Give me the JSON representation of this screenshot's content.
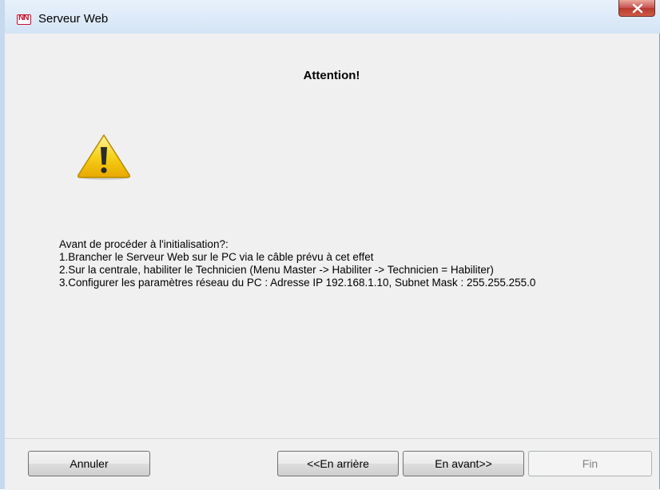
{
  "window": {
    "title": "Serveur Web",
    "icon_label": "NN",
    "close_label": "close"
  },
  "main": {
    "heading": "Attention!",
    "warning_icon": "warning-triangle-icon",
    "lines": [
      "Avant de procéder à l'initialisation?:",
      "1.Brancher le Serveur Web sur le PC via le câble prévu à cet effet",
      "2.Sur la centrale, habiliter le Technicien (Menu Master -> Habiliter -> Technicien = Habiliter)",
      "3.Configurer les paramètres réseau du PC : Adresse IP 192.168.1.10, Subnet Mask : 255.255.255.0"
    ]
  },
  "buttons": {
    "cancel": "Annuler",
    "back": "<<En arrière",
    "next": "En avant>>",
    "finish": "Fin"
  },
  "colors": {
    "close_button": "#c75050",
    "icon_red": "#c8102e",
    "warning_yellow": "#f5c400"
  }
}
